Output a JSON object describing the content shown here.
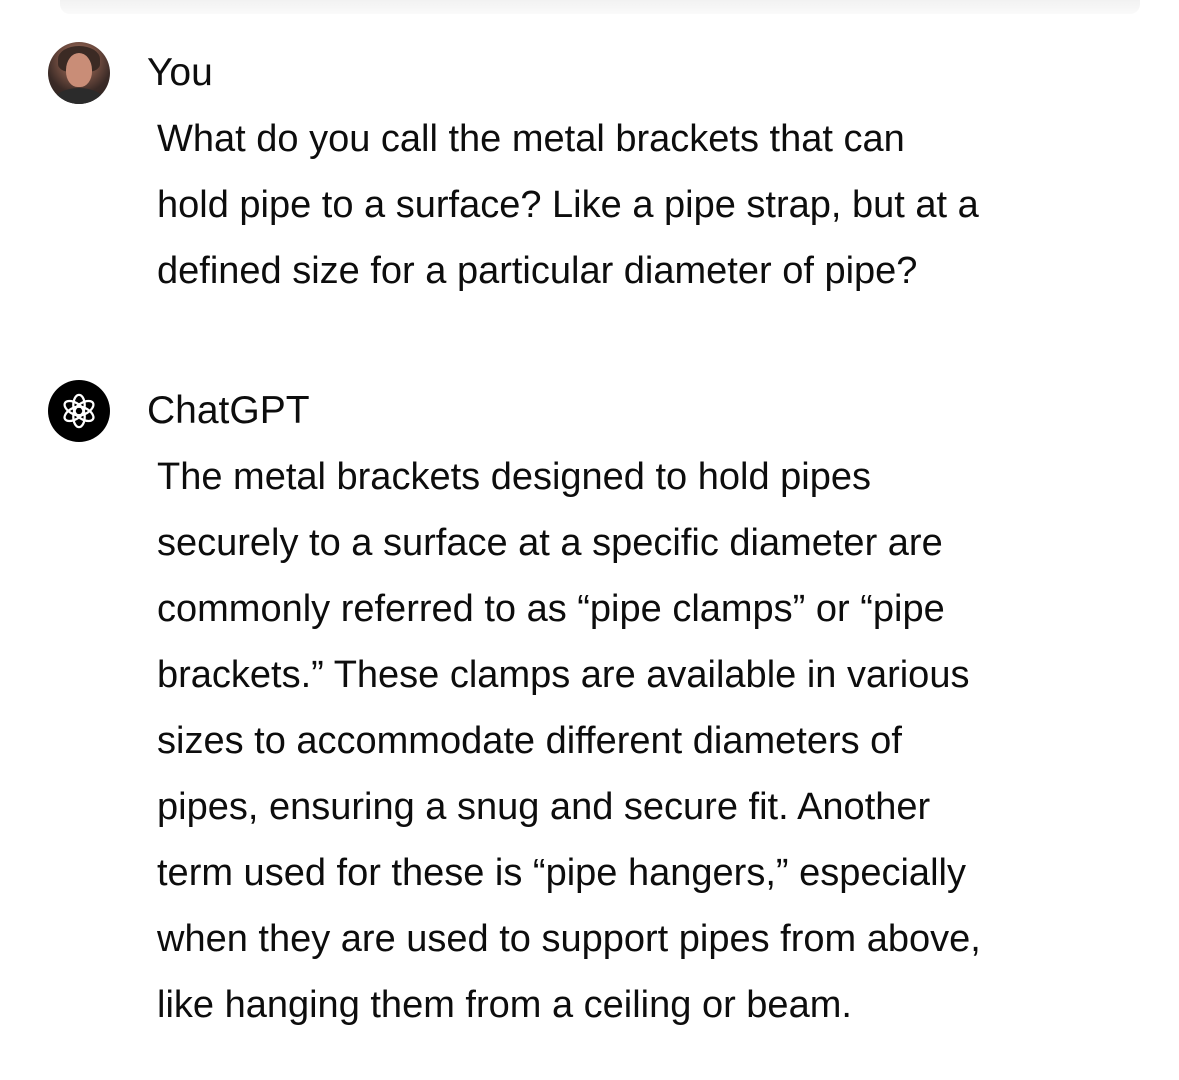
{
  "conversation": {
    "user": {
      "author": "You",
      "lines": [
        "What do you call the metal brackets that can",
        "hold pipe to a surface? Like a pipe strap, but at a",
        "defined size for a particular diameter of pipe?"
      ]
    },
    "assistant": {
      "author": "ChatGPT",
      "lines": [
        "The metal brackets designed to hold pipes",
        "securely to a surface at a specific diameter are",
        "commonly referred to as “pipe clamps” or “pipe",
        "brackets.” These clamps are available in various",
        "sizes to accommodate different diameters of",
        "pipes, ensuring a snug and secure fit. Another",
        "term used for these is “pipe hangers,” especially",
        "when they are used to support pipes from above,",
        "like hanging them from a ceiling or beam."
      ]
    }
  },
  "icons": {
    "user_avatar": "user-photo-avatar",
    "assistant_avatar": "openai-logo-icon"
  },
  "colors": {
    "text": "#0d0d0d",
    "assistant_avatar_bg": "#000000",
    "background": "#ffffff"
  }
}
